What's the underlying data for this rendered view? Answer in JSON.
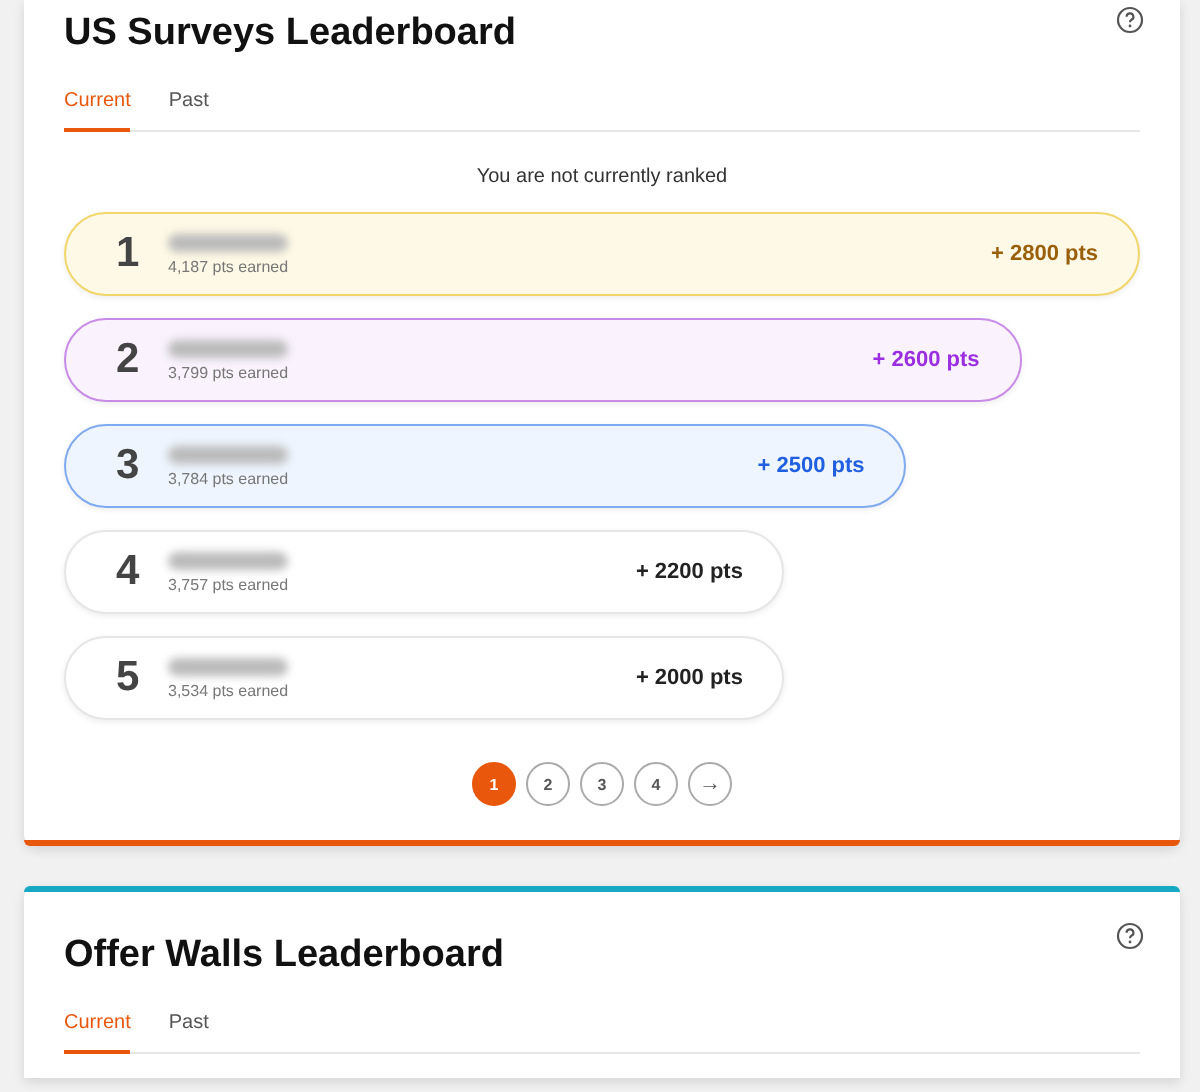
{
  "boards": [
    {
      "title": "US Surveys Leaderboard",
      "color": "#e8570c",
      "tabs": [
        {
          "label": "Current",
          "selected": true
        },
        {
          "label": "Past",
          "selected": false
        }
      ],
      "status": "You are not currently ranked",
      "rows": [
        {
          "kind": "first",
          "rank": "1",
          "earned": "4,187 pts earned",
          "prize": "+ 2800 pts"
        },
        {
          "kind": "second",
          "rank": "2",
          "earned": "3,799 pts earned",
          "prize": "+ 2600 pts"
        },
        {
          "kind": "third",
          "rank": "3",
          "earned": "3,784 pts earned",
          "prize": "+ 2500 pts"
        },
        {
          "kind": "standard",
          "rank": "4",
          "earned": "3,757 pts earned",
          "prize": "+ 2200 pts"
        },
        {
          "kind": "standard",
          "rank": "5",
          "earned": "3,534 pts earned",
          "prize": "+ 2000 pts"
        }
      ],
      "pages": [
        {
          "label": "1",
          "selected": true
        },
        {
          "label": "2",
          "selected": false
        },
        {
          "label": "3",
          "selected": false
        },
        {
          "label": "4",
          "selected": false
        }
      ],
      "next": "→"
    },
    {
      "title": "Offer Walls Leaderboard",
      "color": "#17a9c4",
      "tabs": [
        {
          "label": "Current",
          "selected": true
        },
        {
          "label": "Past",
          "selected": false
        }
      ]
    }
  ]
}
